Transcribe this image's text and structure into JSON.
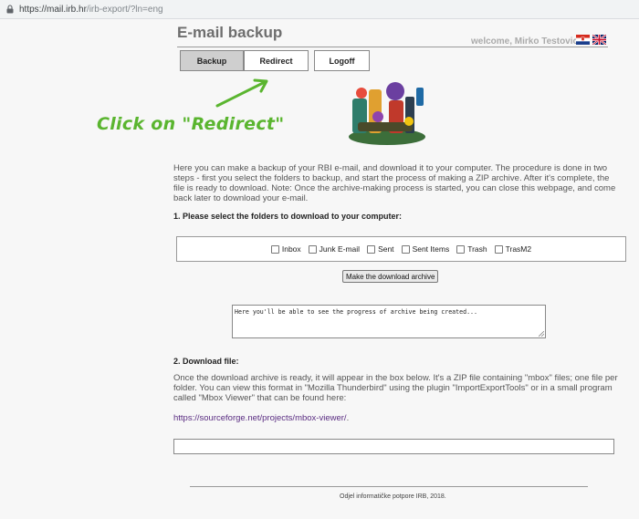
{
  "browser": {
    "url_host": "https://mail.irb.hr",
    "url_path": "/irb-export/?ln=eng"
  },
  "header": {
    "title": "E-mail backup",
    "welcome": "welcome, Mirko Testovic"
  },
  "tabs": [
    {
      "label": "Backup",
      "active": true
    },
    {
      "label": "Redirect",
      "active": false
    },
    {
      "label": "Logoff",
      "active": false
    }
  ],
  "annotation": {
    "callout": "Click on \"Redirect\"",
    "color": "#5ab52f"
  },
  "intro": "Here you can make a backup of your RBI e-mail, and download it to your computer. The procedure is done in two steps - first you select the folders to backup, and start the process of making a ZIP archive. After it's complete, the file is ready to download. Note: Once the archive-making process is started, you can close this webpage, and come back later to download your e-mail.",
  "section1": {
    "heading": "1. Please select the folders to download to your computer:"
  },
  "folders": [
    {
      "label": "Inbox",
      "checked": false
    },
    {
      "label": "Junk E-mail",
      "checked": false
    },
    {
      "label": "Sent",
      "checked": false
    },
    {
      "label": "Sent Items",
      "checked": false
    },
    {
      "label": "Trash",
      "checked": false
    },
    {
      "label": "TrasM2",
      "checked": false
    }
  ],
  "make_button": "Make the download archive",
  "progress_text": "Here you'll be able to see the progress of archive being created...",
  "section2": {
    "heading": "2. Download file:",
    "text": "Once the download archive is ready, it will appear in the box below. It's a ZIP file containing \"mbox\" files; one file per folder. You can view this format in \"Mozilla Thunderbird\" using the plugin \"ImportExportTools\" or in a small program called \"Mbox Viewer\" that can be found here:",
    "link": "https://sourceforge.net/projects/mbox-viewer/",
    "link_suffix": "."
  },
  "footer": "Odjel informatičke potpore IRB, 2018."
}
